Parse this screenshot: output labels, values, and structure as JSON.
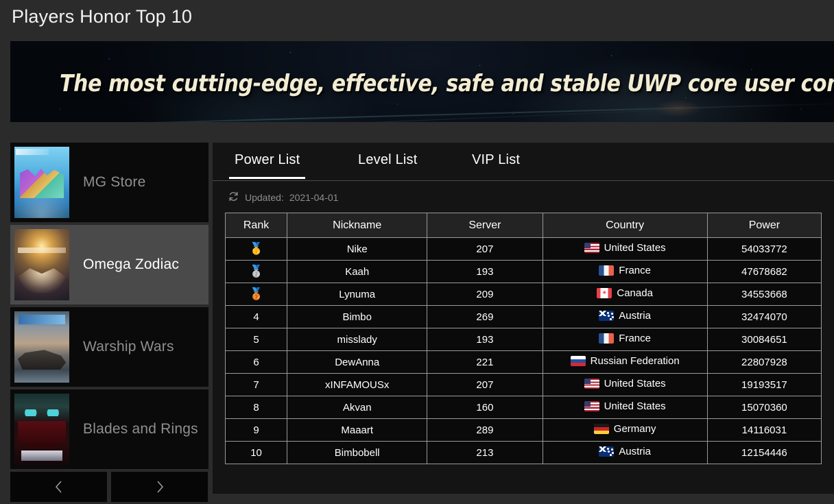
{
  "page": {
    "title": "Players Honor Top 10"
  },
  "banner": {
    "text": "The most cutting-edge, effective, safe and stable UWP core user community"
  },
  "sidebar": {
    "games": [
      {
        "label": "MG Store",
        "thumb": "mg-store-cover",
        "selected": false
      },
      {
        "label": "Omega Zodiac",
        "thumb": "omega-zodiac-cover",
        "selected": true
      },
      {
        "label": "Warship Wars",
        "thumb": "warship-wars-cover",
        "selected": false
      },
      {
        "label": "Blades and Rings",
        "thumb": "blades-and-rings-cover",
        "selected": false
      }
    ],
    "pager": {
      "prev_icon": "chevron-left-icon",
      "next_icon": "chevron-right-icon"
    }
  },
  "content": {
    "tabs": [
      {
        "label": "Power List",
        "active": true
      },
      {
        "label": "Level List",
        "active": false
      },
      {
        "label": "VIP List",
        "active": false
      }
    ],
    "updated": {
      "icon": "refresh-icon",
      "label": "Updated:",
      "date": "2021-04-01"
    },
    "table": {
      "columns": [
        "Rank",
        "Nickname",
        "Server",
        "Country",
        "Power"
      ],
      "rows": [
        {
          "rank": "1",
          "rank_medal": "🥇",
          "nickname": "Nike",
          "server": "207",
          "country": "United States",
          "flag": "us",
          "power": "54033772"
        },
        {
          "rank": "2",
          "rank_medal": "🥈",
          "nickname": "Kaah",
          "server": "193",
          "country": "France",
          "flag": "fr",
          "power": "47678682"
        },
        {
          "rank": "3",
          "rank_medal": "🥉",
          "nickname": "Lynuma",
          "server": "209",
          "country": "Canada",
          "flag": "ca",
          "power": "34553668"
        },
        {
          "rank": "4",
          "rank_medal": "",
          "nickname": "Bimbo",
          "server": "269",
          "country": "Austria",
          "flag": "au",
          "power": "32474070"
        },
        {
          "rank": "5",
          "rank_medal": "",
          "nickname": "misslady",
          "server": "193",
          "country": "France",
          "flag": "fr",
          "power": "30084651"
        },
        {
          "rank": "6",
          "rank_medal": "",
          "nickname": "DewAnna",
          "server": "221",
          "country": "Russian Federation",
          "flag": "ru",
          "power": "22807928"
        },
        {
          "rank": "7",
          "rank_medal": "",
          "nickname": "xINFAMOUSx",
          "server": "207",
          "country": "United States",
          "flag": "us",
          "power": "19193517"
        },
        {
          "rank": "8",
          "rank_medal": "",
          "nickname": "Akvan",
          "server": "160",
          "country": "United States",
          "flag": "us",
          "power": "15070360"
        },
        {
          "rank": "9",
          "rank_medal": "",
          "nickname": "Maaart",
          "server": "289",
          "country": "Germany",
          "flag": "de",
          "power": "14116031"
        },
        {
          "rank": "10",
          "rank_medal": "",
          "nickname": "Bimbobell",
          "server": "213",
          "country": "Austria",
          "flag": "au",
          "power": "12154446"
        }
      ]
    }
  },
  "colors": {
    "page_background": "#2b2b2b",
    "panel_background": "#141414",
    "table_row_background": "#0a0a0a",
    "table_header_background": "#232323",
    "table_border": "#9a9a9a",
    "selected_item_background": "#4a4a4a",
    "banner_text": "#f2ecd2",
    "accent_underline": "#ffffff"
  }
}
